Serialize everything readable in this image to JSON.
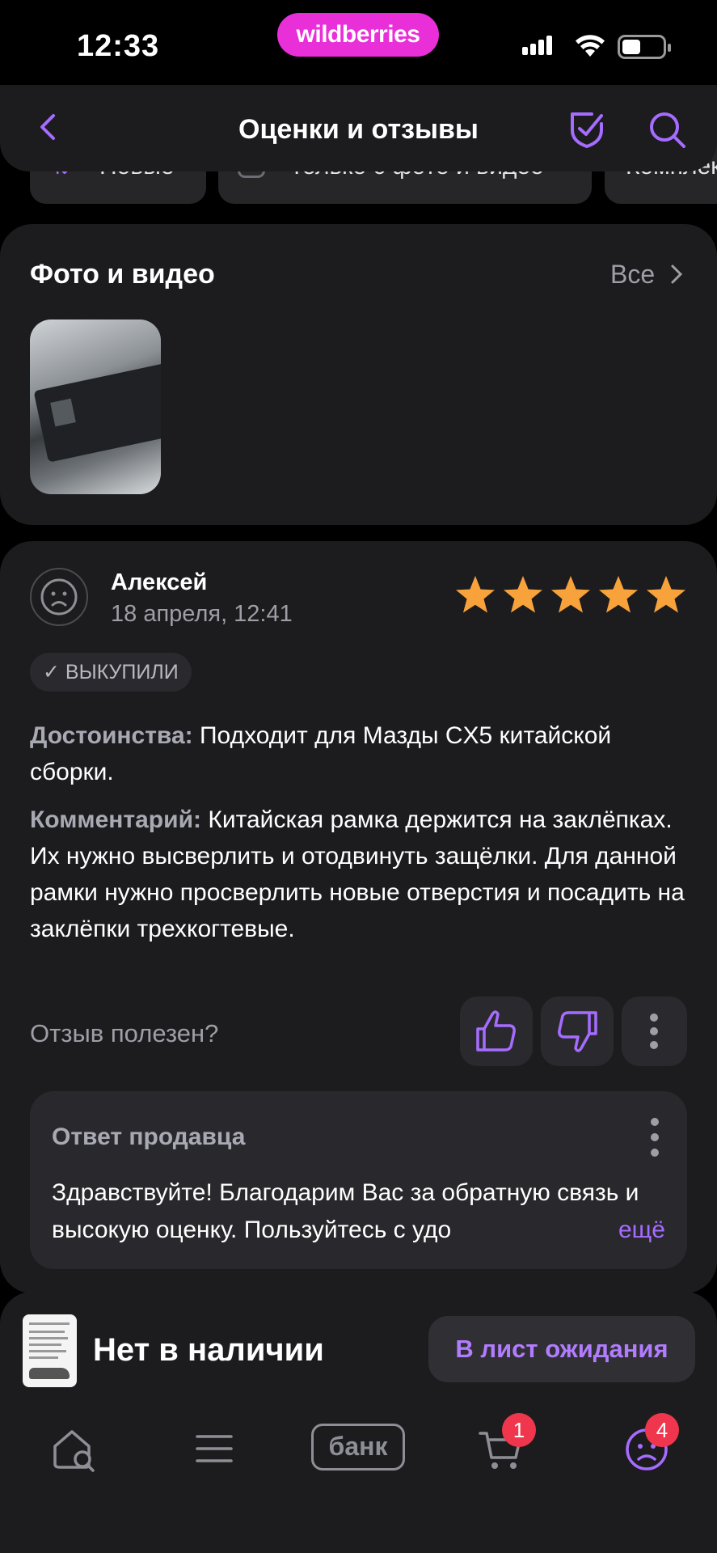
{
  "status_bar": {
    "time": "12:33",
    "brand": "wildberries"
  },
  "header": {
    "title": "Оценки и отзывы"
  },
  "filters": [
    {
      "label": "Новые"
    },
    {
      "label": "Только с фото и видео"
    },
    {
      "label": "Комплект"
    }
  ],
  "photos": {
    "title": "Фото и видео",
    "all_label": "Все"
  },
  "review": {
    "author": "Алексей",
    "date": "18 апреля, 12:41",
    "rating": 5,
    "badge": "✓ ВЫКУПИЛИ",
    "pros_label": "Достоинства:",
    "pros_text": "Подходит для Мазды CX5 китайской сборки.",
    "comment_label": "Комментарий:",
    "comment_text": "Китайская рамка держится на заклёпках. Их нужно высверлить и отодвинуть защёлки. Для данной рамки нужно просверлить новые отверстия и посадить на заклёпки трехкогтевые.",
    "useful_label": "Отзыв полезен?",
    "seller_reply": {
      "title": "Ответ продавца",
      "text": "Здравствуйте! Благодарим Вас за обратную связь и высокую оценку. Пользуйтесь с удо",
      "more_label": "ещё"
    }
  },
  "product": {
    "stock_status": "Нет в наличии",
    "waitlist_label": "В лист ожидания"
  },
  "nav": {
    "bank_label": "банк",
    "cart_count": "1",
    "profile_count": "4"
  },
  "colors": {
    "accent": "#a66cff",
    "brand": "#e92fd8",
    "star": "#f7a23b",
    "badge": "#f0364d"
  }
}
